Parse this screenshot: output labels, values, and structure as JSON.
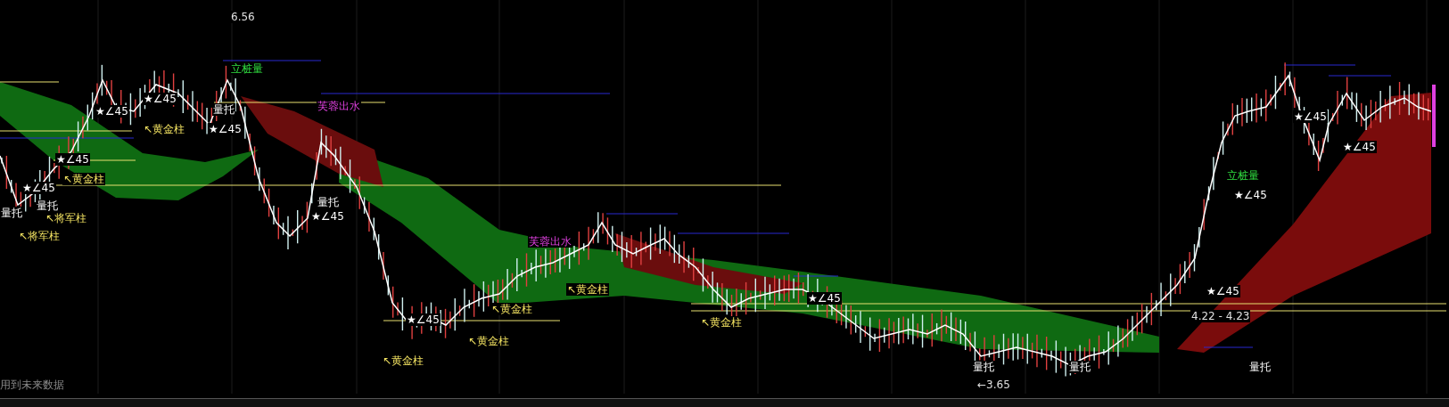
{
  "chart": {
    "annotations": [
      {
        "kind": "price",
        "text": "6.56"
      },
      {
        "kind": "signal",
        "text": "立桩量"
      },
      {
        "kind": "signal",
        "text": "立桩量"
      },
      {
        "kind": "angle",
        "text": "★∠45"
      },
      {
        "kind": "angle",
        "text": "★∠45"
      },
      {
        "kind": "angle",
        "text": "★∠45"
      },
      {
        "kind": "angle",
        "text": "★∠45"
      },
      {
        "kind": "angle",
        "text": "★∠45"
      },
      {
        "kind": "angle",
        "text": "★∠45"
      },
      {
        "kind": "angle",
        "text": "★∠45"
      },
      {
        "kind": "angle",
        "text": "★∠45"
      },
      {
        "kind": "angle",
        "text": "★∠45"
      },
      {
        "kind": "angle",
        "text": "★∠45"
      },
      {
        "kind": "angle",
        "text": "★∠45"
      },
      {
        "kind": "angle",
        "text": "★∠45"
      },
      {
        "kind": "column",
        "text": "↖黄金柱"
      },
      {
        "kind": "column",
        "text": "↖黄金柱"
      },
      {
        "kind": "column",
        "text": "↖黄金柱"
      },
      {
        "kind": "column",
        "text": "↖黄金柱"
      },
      {
        "kind": "column",
        "text": "↖黄金柱"
      },
      {
        "kind": "column",
        "text": "↖黄金柱"
      },
      {
        "kind": "column",
        "text": "↖黄金柱"
      },
      {
        "kind": "column",
        "text": "↖将军柱"
      },
      {
        "kind": "column",
        "text": "↖将军柱"
      },
      {
        "kind": "alert",
        "text": "芙蓉出水"
      },
      {
        "kind": "alert",
        "text": "芙蓉出水"
      },
      {
        "kind": "support",
        "text": "量托"
      },
      {
        "kind": "support",
        "text": "量托"
      },
      {
        "kind": "support",
        "text": "量托"
      },
      {
        "kind": "support",
        "text": "量托"
      },
      {
        "kind": "support",
        "text": "量托"
      },
      {
        "kind": "support",
        "text": "量托"
      },
      {
        "kind": "support",
        "text": "量托"
      },
      {
        "kind": "price",
        "text": "←3.65"
      },
      {
        "kind": "price",
        "text": "4.22 - 4.23"
      }
    ]
  },
  "footer_note": "用到未来数据"
}
